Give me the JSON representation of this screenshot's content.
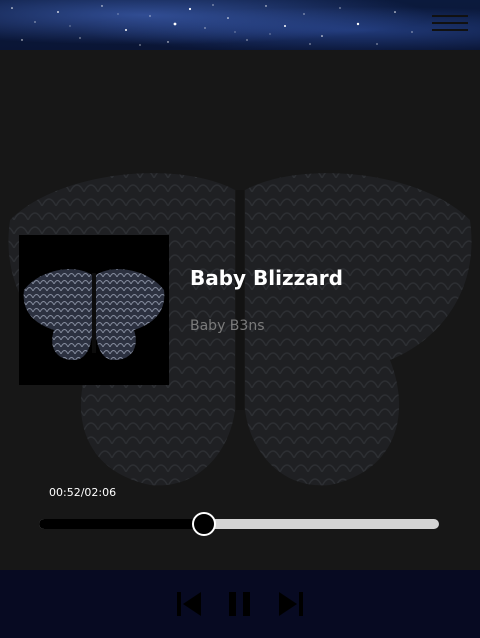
{
  "header": {
    "menu_icon": "hamburger-menu-icon"
  },
  "track": {
    "title": "Baby Blizzard",
    "artist": "Baby B3ns",
    "album_art_icon": "butterfly-album-art"
  },
  "playback": {
    "current_time": "00:52",
    "separator": "/",
    "total_time": "02:06",
    "progress_fraction": 0.413
  },
  "controls": {
    "previous_icon": "skip-previous-icon",
    "pause_icon": "pause-icon",
    "next_icon": "skip-next-icon"
  },
  "colors": {
    "background": "#171717",
    "controls_bar": "#070a22",
    "progress_track": "#d4d4d4",
    "progress_fill": "#000000",
    "title": "#ffffff",
    "artist": "#7b7b7b"
  }
}
